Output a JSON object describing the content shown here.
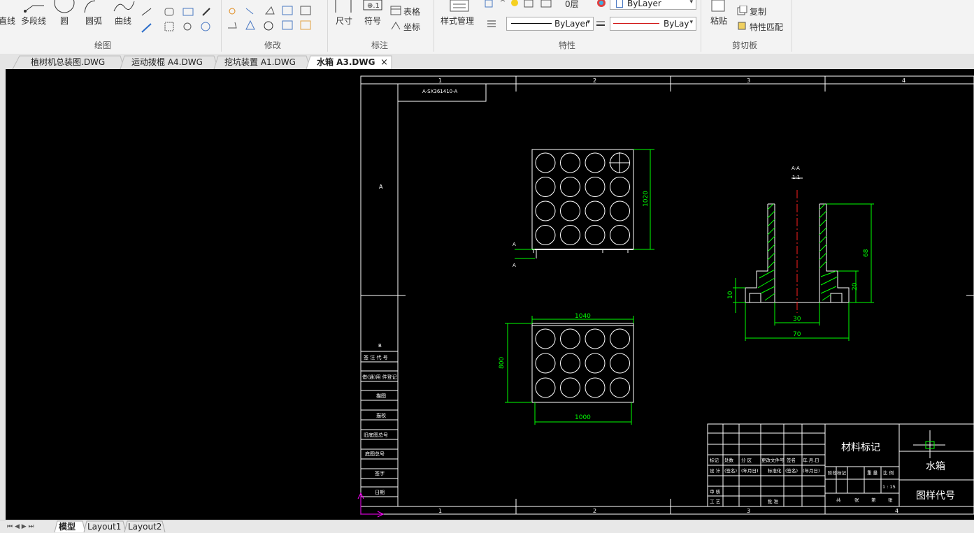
{
  "ribbon": {
    "draw": {
      "line": "直线",
      "polyline": "多段线",
      "circle": "圆",
      "arc": "圆弧",
      "curve": "曲线",
      "group": "绘图"
    },
    "modify": {
      "group": "修改"
    },
    "annotate": {
      "dimension": "尺寸",
      "symbol": "符号",
      "table": "表格",
      "coord": "坐标",
      "group": "标注"
    },
    "props": {
      "style_manager": "样式管理",
      "layer": "0层",
      "color": "ByLayer",
      "linetype": "ByLayer",
      "lineweight": "ByLay",
      "group": "特性"
    },
    "clipboard": {
      "paste": "粘贴",
      "copy": "复制",
      "match": "特性匹配",
      "group": "剪切板"
    }
  },
  "tabs": [
    {
      "label": "植树机总装图.DWG",
      "active": false
    },
    {
      "label": "运动拨棍 A4.DWG",
      "active": false
    },
    {
      "label": "挖坑装置 A1.DWG",
      "active": false
    },
    {
      "label": "水箱 A3.DWG",
      "active": true
    }
  ],
  "tab_close": "×",
  "bottom_tabs": {
    "model": "模型",
    "layout1": "Layout1",
    "layout2": "Layout2"
  },
  "drawing": {
    "zone_top": [
      "1",
      "2",
      "3",
      "4"
    ],
    "zone_left": "A",
    "code_box": "A-SX361410-A",
    "plan_top": {
      "dim_height": "1020",
      "tags": [
        "A",
        "A"
      ]
    },
    "plan_bottom": {
      "dim_top": "1040",
      "dim_left": "800",
      "dim_bottom": "1000"
    },
    "section": {
      "title": "A-A",
      "scale": "1:1",
      "dim_68": "68",
      "dim_20": "20",
      "dim_10": "10",
      "dim_30": "30",
      "dim_70": "70"
    },
    "side_table": [
      "B",
      "签 注 代 号",
      "借(通)用 件登记",
      "描图",
      "描校",
      "旧底图总号",
      "底图总号",
      "签字",
      "日期"
    ],
    "title_block": {
      "material": "材料标记",
      "name": "水箱",
      "code": "图样代号",
      "scale": "1 : 15",
      "row_labels": [
        "标记",
        "处数",
        "分 区",
        "更改文件号",
        "签名",
        "年.月.日"
      ],
      "row2": [
        "设 计",
        "(签名)",
        "(年月日)",
        "标准化",
        "(签名)",
        "(年月日)"
      ],
      "row3": [
        "审 核"
      ],
      "row4": [
        "工 艺",
        "批 准"
      ],
      "stage": [
        "阶段标记",
        "重 量",
        "比 例"
      ],
      "sheet": [
        "共",
        "张",
        "第",
        "张"
      ]
    }
  },
  "colors": {
    "accent": "#00ff00",
    "hatch": "#00ff00",
    "center": "#ff2020",
    "line": "#ffffff",
    "ucs": "#ff00ff"
  }
}
